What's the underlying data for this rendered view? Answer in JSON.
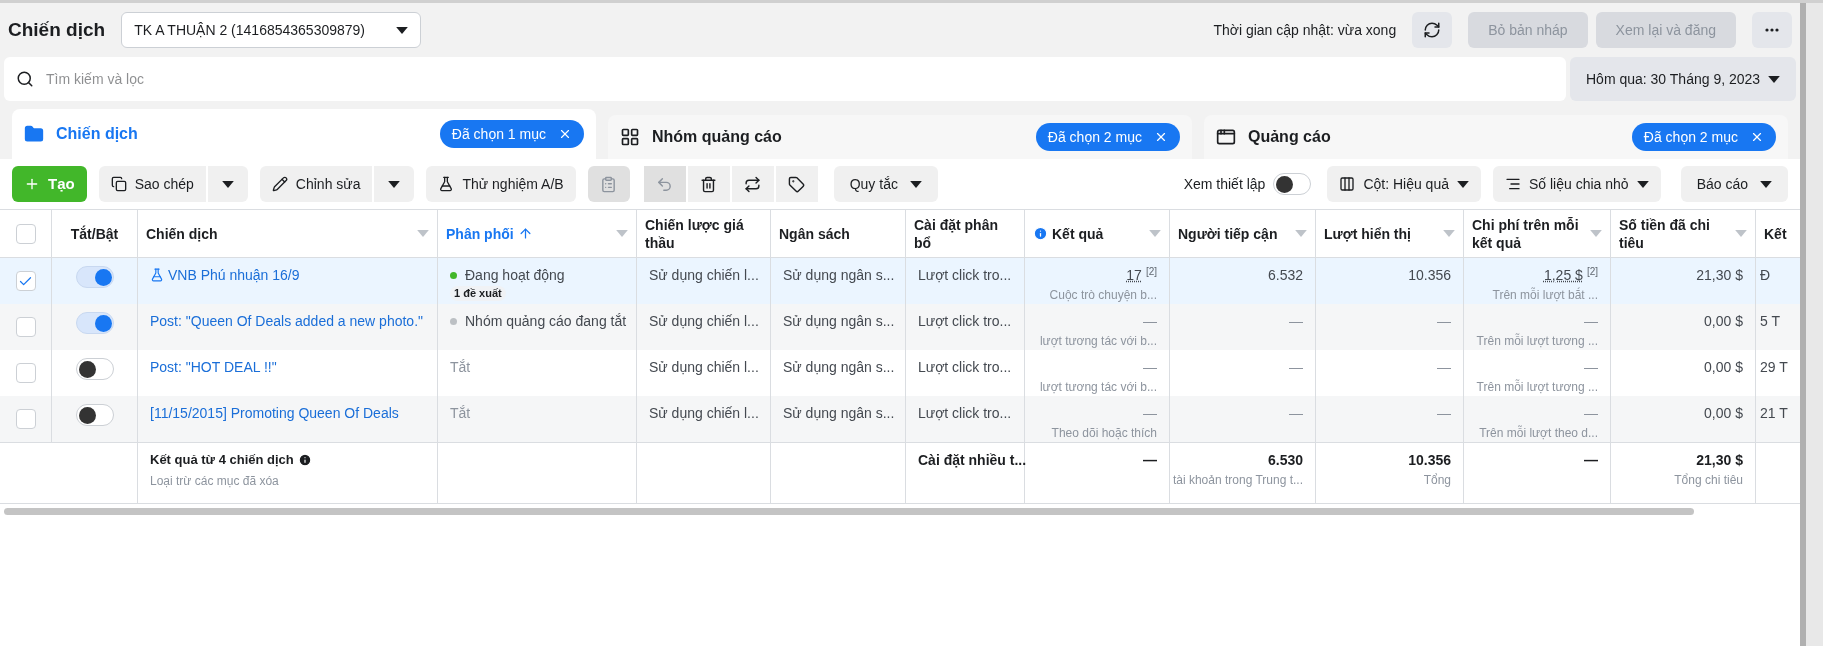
{
  "header": {
    "title": "Chiến dịch",
    "account": "TK A THUẬN 2 (1416854365309879)",
    "update_time": "Thời gian cập nhật: vừa xong",
    "buttons": [
      {
        "label": "Bỏ bản nháp",
        "disabled": true
      },
      {
        "label": "Xem lại và đăng",
        "disabled": true
      }
    ]
  },
  "search": {
    "placeholder": "Tìm kiếm và lọc"
  },
  "date_range": "Hôm qua: 30 Tháng 9, 2023",
  "tabs": [
    {
      "label": "Chiến dịch",
      "selected": true,
      "chip": "Đã chọn 1 mục"
    },
    {
      "label": "Nhóm quảng cáo",
      "selected": false,
      "chip": "Đã chọn 2 mục"
    },
    {
      "label": "Quảng cáo",
      "selected": false,
      "chip": "Đã chọn 2 mục"
    }
  ],
  "toolbar": {
    "create": "Tạo",
    "split_buttons": [
      "Sao chép",
      "Chỉnh sửa"
    ],
    "ab_test": "Thử nghiệm A/B",
    "icon_tools": [
      {
        "disabled": true
      },
      {
        "disabled": true
      },
      {
        "disabled": false
      },
      {
        "disabled": false
      },
      {
        "disabled": false
      }
    ],
    "rules": "Quy tắc",
    "view_setup": {
      "label": "Xem thiết lập",
      "on": false
    },
    "columns": "Cột: Hiệu quả",
    "breakdown": "Số liệu chia nhỏ",
    "reports": "Báo cáo"
  },
  "table": {
    "select_all": {
      "checked": false
    },
    "columns": [
      {
        "label": "Tắt/Bật",
        "menu": false,
        "sorted": false,
        "info": false
      },
      {
        "label": "Chiến dịch",
        "menu": true,
        "sorted": false,
        "info": false
      },
      {
        "label": "Phân phối",
        "menu": true,
        "sorted": true,
        "info": false
      },
      {
        "label": "Chiến lược giá thầu",
        "menu": false,
        "sorted": false,
        "info": false
      },
      {
        "label": "Ngân sách",
        "menu": false,
        "sorted": false,
        "info": false
      },
      {
        "label": "Cài đặt phân bổ",
        "menu": false,
        "sorted": false,
        "info": false
      },
      {
        "label": "Kết quả",
        "menu": true,
        "sorted": false,
        "info": true
      },
      {
        "label": "Người tiếp cận",
        "menu": true,
        "sorted": false,
        "info": false
      },
      {
        "label": "Lượt hiển thị",
        "menu": true,
        "sorted": false,
        "info": false
      },
      {
        "label": "Chi phí trên mỗi kết quả",
        "menu": true,
        "sorted": false,
        "info": false
      },
      {
        "label": "Số tiền đã chi tiêu",
        "menu": true,
        "sorted": false,
        "info": false
      },
      {
        "label": "Kết",
        "menu": false,
        "sorted": false,
        "info": false
      }
    ],
    "rows": [
      {
        "selected": true,
        "cells": [
          {
            "kind": "toggle",
            "on": true
          },
          {
            "kind": "name",
            "text": "VNB Phú nhuận 16/9",
            "experiment": true
          },
          {
            "kind": "delivery",
            "text": "Đang hoạt động",
            "color": "#42b72a",
            "badge": "1 đề xuất"
          },
          {
            "text": "Sử dụng chiến l..."
          },
          {
            "text": "Sử dụng ngân s..."
          },
          {
            "text": "Lượt click tro..."
          },
          {
            "text": "17",
            "note": "[2]",
            "sub": "Cuộc trò chuyện b..."
          },
          {
            "text": "6.532"
          },
          {
            "text": "10.356"
          },
          {
            "text": "1,25 $",
            "note": "[2]",
            "sub": "Trên mỗi lượt bắt ..."
          },
          {
            "text": "21,30 $"
          },
          {
            "text": "Đ"
          }
        ]
      },
      {
        "selected": false,
        "cells": [
          {
            "kind": "toggle",
            "on": true
          },
          {
            "kind": "name",
            "text": "Post: \"Queen Of Deals added a new photo.\"",
            "experiment": false
          },
          {
            "kind": "delivery",
            "text": "Nhóm quảng cáo đang tắt",
            "color": "#bcc0c4"
          },
          {
            "text": "Sử dụng chiến l..."
          },
          {
            "text": "Sử dụng ngân s..."
          },
          {
            "text": "Lượt click tro..."
          },
          {
            "text": "—",
            "sub": "lượt tương tác với b..."
          },
          {
            "text": "—"
          },
          {
            "text": "—"
          },
          {
            "text": "—",
            "sub": "Trên mỗi lượt tương ..."
          },
          {
            "text": "0,00 $"
          },
          {
            "text": "5 T"
          }
        ]
      },
      {
        "selected": false,
        "cells": [
          {
            "kind": "toggle",
            "on": false
          },
          {
            "kind": "name",
            "text": "Post: \"HOT DEAL !!\"",
            "experiment": false
          },
          {
            "kind": "delivery",
            "text": "Tắt"
          },
          {
            "text": "Sử dụng chiến l..."
          },
          {
            "text": "Sử dụng ngân s..."
          },
          {
            "text": "Lượt click tro..."
          },
          {
            "text": "—",
            "sub": "lượt tương tác với b..."
          },
          {
            "text": "—"
          },
          {
            "text": "—"
          },
          {
            "text": "—",
            "sub": "Trên mỗi lượt tương ..."
          },
          {
            "text": "0,00 $"
          },
          {
            "text": "29 T"
          }
        ]
      },
      {
        "selected": false,
        "cells": [
          {
            "kind": "toggle",
            "on": false
          },
          {
            "kind": "name",
            "text": "[11/15/2015] Promoting Queen Of Deals",
            "experiment": false
          },
          {
            "kind": "delivery",
            "text": "Tắt"
          },
          {
            "text": "Sử dụng chiến l..."
          },
          {
            "text": "Sử dụng ngân s..."
          },
          {
            "text": "Lượt click tro..."
          },
          {
            "text": "—",
            "sub": "Theo dõi hoặc thích"
          },
          {
            "text": "—"
          },
          {
            "text": "—"
          },
          {
            "text": "—",
            "sub": "Trên mỗi lượt theo d..."
          },
          {
            "text": "0,00 $"
          },
          {
            "text": "21 T"
          }
        ]
      }
    ],
    "summary": {
      "cells": [
        null,
        {
          "kind": "summary",
          "text": "Kết quả từ 4 chiến dịch",
          "sub": "Loại trừ các mục đã xóa"
        },
        null,
        null,
        null,
        {
          "text": "Cài đặt nhiều t..."
        },
        {
          "text": "—"
        },
        {
          "text": "6.530",
          "sub": "tài khoản trong Trung t..."
        },
        {
          "text": "10.356",
          "sub": "Tổng"
        },
        {
          "text": "—"
        },
        {
          "text": "21,30 $",
          "sub": "Tổng chi tiêu"
        },
        null
      ]
    }
  }
}
